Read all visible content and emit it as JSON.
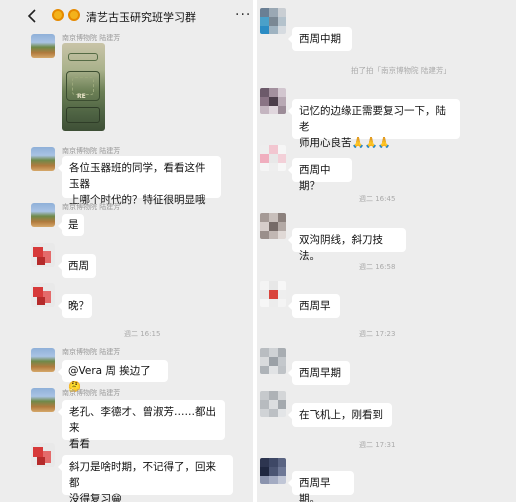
{
  "header": {
    "title": "清艺古玉研究班学习群",
    "more_label": "···"
  },
  "left": {
    "messages": [
      {
        "sender": "南京博物院 陆建芳",
        "image_caption": "RE"
      },
      {
        "sender": "南京博物院 陆建芳",
        "text_1": "各位玉器班的同学，看看这件玉器",
        "text_2": "上哪个时代的？特征很明显哦"
      },
      {
        "sender": "南京博物院 陆建芳",
        "text_1": "是"
      },
      {
        "text_1": "西周"
      },
      {
        "text_1": "晚？"
      },
      {
        "time": "週二 16:15"
      },
      {
        "sender": "南京博物院 陆建芳",
        "text_1": "@Vera  周  挨边了🤔"
      },
      {
        "sender": "南京博物院 陆建芳",
        "text_1": "老孔、李德才、曾淑芳……都出来",
        "text_2": "看看"
      },
      {
        "text_1": "斜刀是啥时期，不记得了，回来都",
        "text_2": "没得复习😁"
      }
    ]
  },
  "right": {
    "messages": [
      {
        "text_1": "西周中期"
      },
      {
        "system": "拍了拍「南京博物院 陆建芳」"
      },
      {
        "text_1": "记忆的边缘正需要复习一下，陆老",
        "text_2": "师用心良苦🙏🙏🙏"
      },
      {
        "text_1": "西周中期？"
      },
      {
        "time": "週二 16:45"
      },
      {
        "text_1": "双沟阴线，斜刀技法。"
      },
      {
        "time": "週二 16:58"
      },
      {
        "text_1": "西周早"
      },
      {
        "time": "週二 17:23"
      },
      {
        "text_1": "西周早期"
      },
      {
        "text_1": "在飞机上，刚看到"
      },
      {
        "time": "週二 17:31"
      },
      {
        "text_1": "西周早期。"
      }
    ]
  }
}
